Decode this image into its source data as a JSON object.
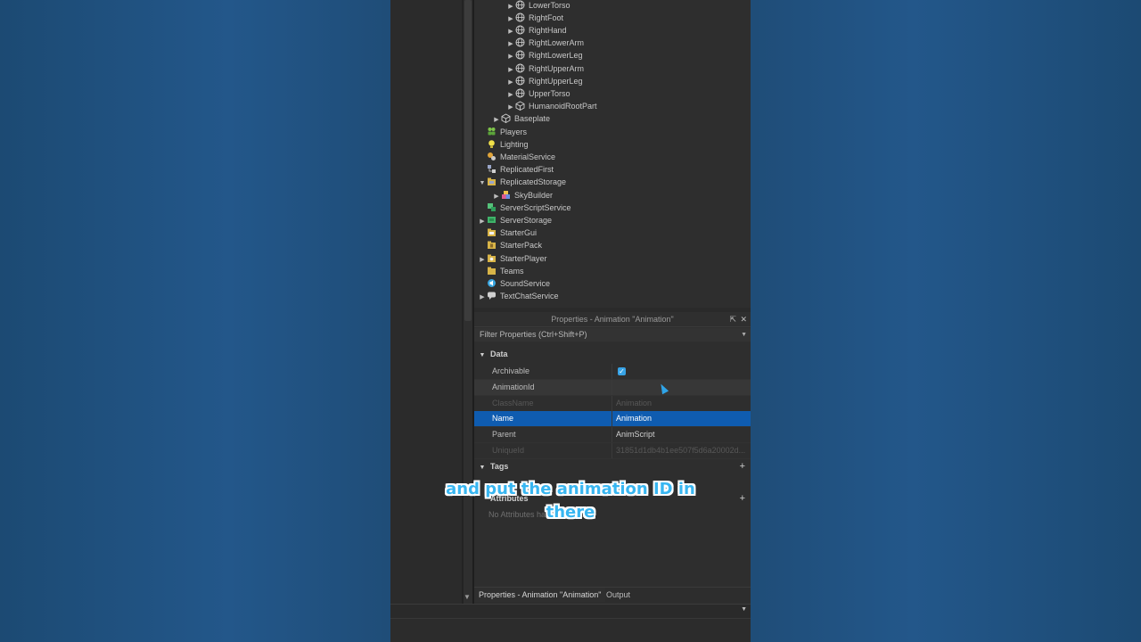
{
  "explorer": {
    "items": [
      {
        "label": "LowerTorso",
        "icon": "mesh-part-icon",
        "expanded": false
      },
      {
        "label": "RightFoot",
        "icon": "mesh-part-icon",
        "expanded": false
      },
      {
        "label": "RightHand",
        "icon": "mesh-part-icon",
        "expanded": false
      },
      {
        "label": "RightLowerArm",
        "icon": "mesh-part-icon",
        "expanded": false
      },
      {
        "label": "RightLowerLeg",
        "icon": "mesh-part-icon",
        "expanded": false
      },
      {
        "label": "RightUpperArm",
        "icon": "mesh-part-icon",
        "expanded": false
      },
      {
        "label": "RightUpperLeg",
        "icon": "mesh-part-icon",
        "expanded": false
      },
      {
        "label": "UpperTorso",
        "icon": "mesh-part-icon",
        "expanded": false
      },
      {
        "label": "HumanoidRootPart",
        "icon": "part-icon",
        "expanded": false
      },
      {
        "label": "Baseplate",
        "icon": "part-icon",
        "expanded": false
      },
      {
        "label": "Players",
        "icon": "players-icon"
      },
      {
        "label": "Lighting",
        "icon": "lighting-icon"
      },
      {
        "label": "MaterialService",
        "icon": "material-service-icon"
      },
      {
        "label": "ReplicatedFirst",
        "icon": "replicated-first-icon"
      },
      {
        "label": "ReplicatedStorage",
        "icon": "replicated-storage-icon",
        "expanded": true
      },
      {
        "label": "SkyBuilder",
        "icon": "model-icon",
        "expanded": false
      },
      {
        "label": "ServerScriptService",
        "icon": "server-script-service-icon"
      },
      {
        "label": "ServerStorage",
        "icon": "server-storage-icon",
        "expanded": false
      },
      {
        "label": "StarterGui",
        "icon": "starter-gui-icon"
      },
      {
        "label": "StarterPack",
        "icon": "starter-pack-icon"
      },
      {
        "label": "StarterPlayer",
        "icon": "starter-player-icon",
        "expanded": false
      },
      {
        "label": "Teams",
        "icon": "teams-icon"
      },
      {
        "label": "SoundService",
        "icon": "sound-service-icon"
      },
      {
        "label": "TextChatService",
        "icon": "text-chat-service-icon",
        "expanded": false
      }
    ]
  },
  "properties": {
    "title": "Properties - Animation \"Animation\"",
    "filter_placeholder": "Filter Properties (Ctrl+Shift+P)",
    "sections": {
      "data": "Data",
      "tags": "Tags",
      "attributes": "Attributes"
    },
    "rows": {
      "archivable": {
        "name": "Archivable",
        "checked": true
      },
      "animation_id": {
        "name": "AnimationId",
        "value": ""
      },
      "class_name": {
        "name": "ClassName",
        "value": "Animation"
      },
      "name": {
        "name": "Name",
        "value": "Animation"
      },
      "parent": {
        "name": "Parent",
        "value": "AnimScript"
      },
      "unique_id": {
        "name": "UniqueId",
        "value": "31851d1db4b1ee507f5d6a20002d..."
      }
    },
    "no_attributes": "No Attributes have been set",
    "tabs": {
      "properties": "Properties - Animation \"Animation\"",
      "output": "Output"
    }
  },
  "caption": {
    "line1": "and put the animation ID in",
    "line2": "there"
  },
  "colors": {
    "background": "#1f4d78",
    "selection": "#0f5cb0",
    "caption_fill": "#38b6f1"
  }
}
